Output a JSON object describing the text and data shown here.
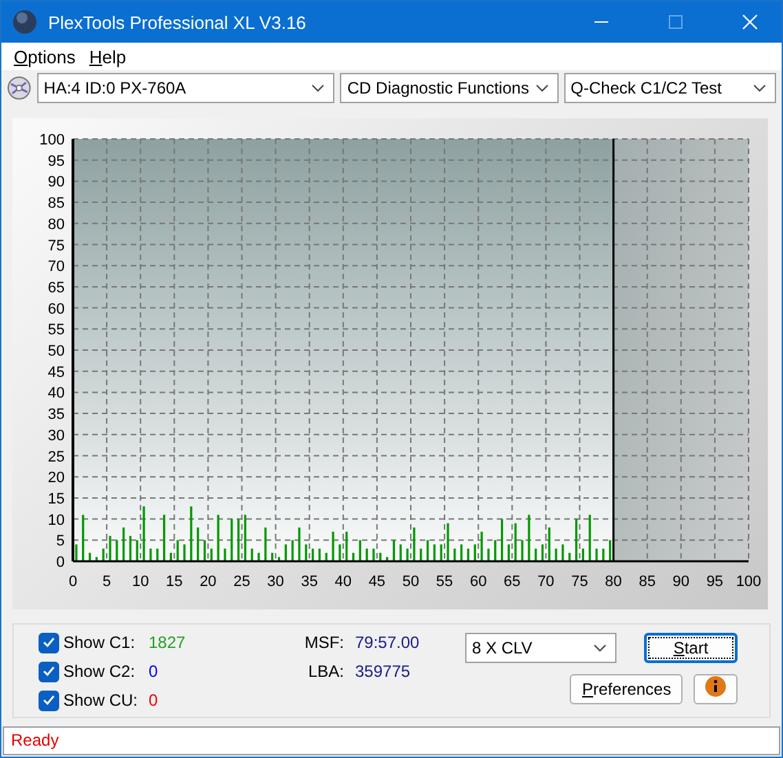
{
  "window": {
    "title": "PlexTools Professional XL V3.16"
  },
  "menu": [
    {
      "label": "Options"
    },
    {
      "label": "Help"
    }
  ],
  "toolbar": {
    "drive": "HA:4 ID:0  PX-760A",
    "function": "CD Diagnostic Functions",
    "test": "Q-Check C1/C2 Test"
  },
  "chart": {
    "chart_data": {
      "type": "bar",
      "x": [
        0.5,
        1.5,
        2.5,
        3.5,
        4.5,
        5.5,
        6.5,
        7.5,
        8.5,
        9.5,
        10.5,
        11.5,
        12.5,
        13.5,
        14.5,
        15.5,
        16.5,
        17.5,
        18.5,
        19.5,
        20.5,
        21.5,
        22.5,
        23.5,
        24.5,
        25.5,
        26.5,
        27.5,
        28.5,
        29.5,
        30.5,
        31.5,
        32.5,
        33.5,
        34.5,
        35.5,
        36.5,
        37.5,
        38.5,
        39.5,
        40.5,
        41.5,
        42.5,
        43.5,
        44.5,
        45.5,
        46.5,
        47.5,
        48.5,
        49.5,
        50.5,
        51.5,
        52.5,
        53.5,
        54.5,
        55.5,
        56.5,
        57.5,
        58.5,
        59.5,
        60.5,
        61.5,
        62.5,
        63.5,
        64.5,
        65.5,
        66.5,
        67.5,
        68.5,
        69.5,
        70.5,
        71.5,
        72.5,
        73.5,
        74.5,
        75.5,
        76.5,
        77.5,
        78.5,
        79.5
      ],
      "grid": true,
      "bands": [
        {
          "axis": "x",
          "from": 80,
          "to": 100
        }
      ],
      "ref_lines": [
        {
          "axis": "x",
          "value": 80,
          "color": "#000000"
        }
      ],
      "series": [
        {
          "color": "#009900",
          "values": [
            4,
            11,
            2,
            1,
            3,
            6,
            5,
            8,
            6,
            5,
            13,
            3,
            3,
            11,
            2,
            5,
            4,
            13,
            8,
            5,
            3,
            11,
            3,
            10,
            10,
            11,
            3,
            2,
            8,
            2,
            1,
            4,
            5,
            8,
            4,
            3,
            3,
            2,
            7,
            4,
            7,
            2,
            5,
            3,
            3,
            2,
            1,
            5,
            4,
            3,
            8,
            3,
            5,
            4,
            4,
            9,
            3,
            4,
            3,
            4,
            7,
            3,
            5,
            10,
            4,
            9,
            5,
            11,
            3,
            4,
            8,
            3,
            4,
            2,
            10,
            3,
            11,
            3,
            3,
            5
          ]
        }
      ],
      "xlim": [
        0,
        100
      ],
      "ylim": [
        0,
        100
      ],
      "xticks": [
        0,
        5,
        10,
        15,
        20,
        25,
        30,
        35,
        40,
        45,
        50,
        55,
        60,
        65,
        70,
        75,
        80,
        85,
        90,
        95,
        100
      ],
      "yticks": [
        0,
        5,
        10,
        15,
        20,
        25,
        30,
        35,
        40,
        45,
        50,
        55,
        60,
        65,
        70,
        75,
        80,
        85,
        90,
        95,
        100
      ]
    }
  },
  "stats": [
    {
      "label": "Show C1:",
      "checked": true,
      "value": "1827",
      "color": "#22a022"
    },
    {
      "label": "Show C2:",
      "checked": true,
      "value": "0",
      "color": "#0000ee"
    },
    {
      "label": "Show CU:",
      "checked": true,
      "value": "0",
      "color": "#ee0000"
    }
  ],
  "position": [
    {
      "label": "MSF:",
      "value": "79:57.00"
    },
    {
      "label": "LBA:",
      "value": "359775"
    }
  ],
  "speed": "8 X CLV",
  "buttons": {
    "start": "Start",
    "preferences": "Preferences"
  },
  "status": "Ready"
}
